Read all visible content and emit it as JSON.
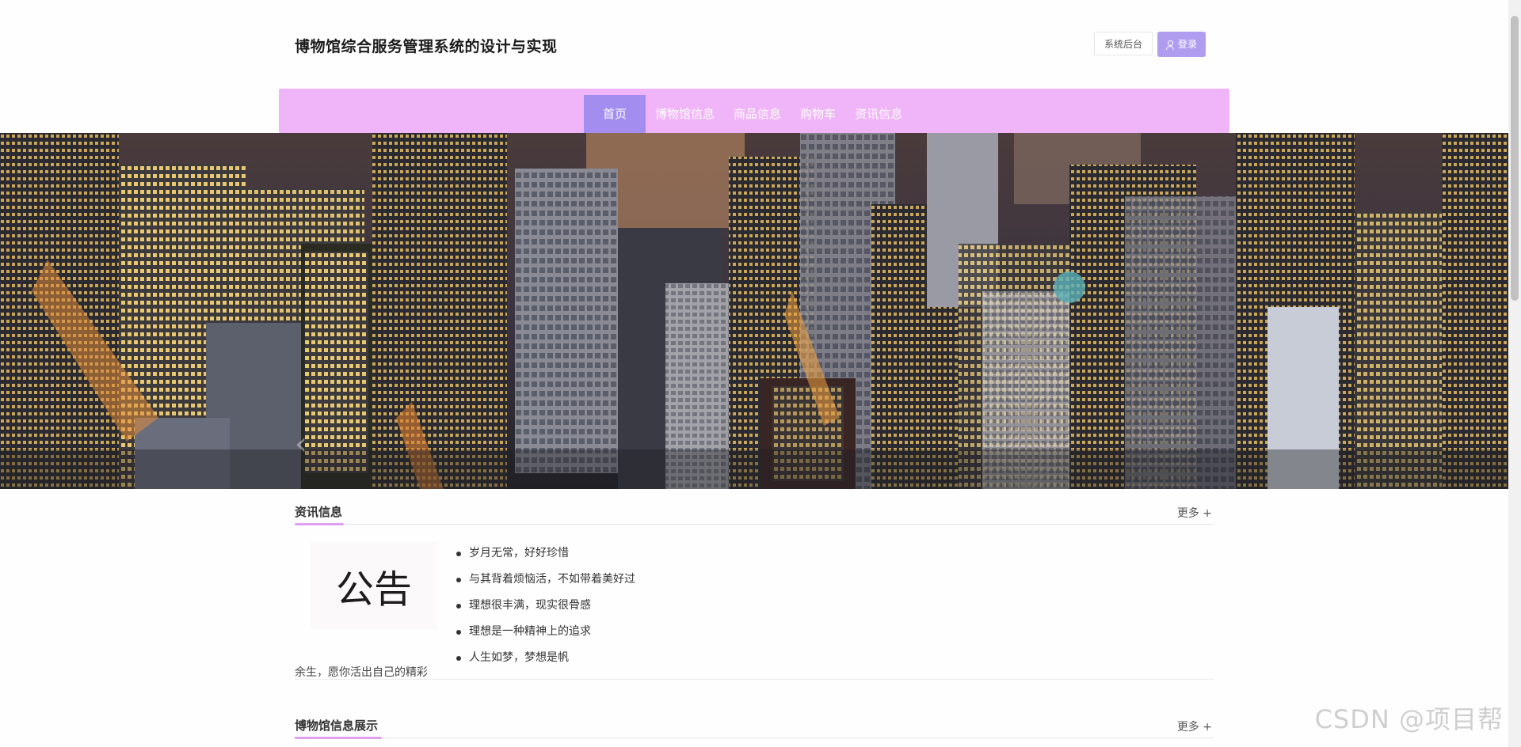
{
  "header": {
    "title": "博物馆综合服务管理系统的设计与实现",
    "admin_button": "系统后台",
    "login_button": "登录",
    "login_icon": "user-icon"
  },
  "nav": {
    "items": [
      {
        "label": "首页",
        "active": true
      },
      {
        "label": "博物馆信息",
        "active": false
      },
      {
        "label": "商品信息",
        "active": false
      },
      {
        "label": "购物车",
        "active": false
      },
      {
        "label": "资讯信息",
        "active": false
      }
    ]
  },
  "banner": {
    "prev_glyph": "‹",
    "image_description": "city-skyline-night"
  },
  "news_section": {
    "title": "资讯信息",
    "more": "更多 +",
    "notice_card": "公告",
    "description": "余生，愿你活出自己的精彩",
    "items": [
      "岁月无常，好好珍惜",
      "与其背着烦恼活，不如带着美好过",
      "理想很丰满，现实很骨感",
      "理想是一种精神上的追求",
      "人生如梦，梦想是帆"
    ]
  },
  "museum_section": {
    "title": "博物馆信息展示",
    "more": "更多 +"
  },
  "watermark": "CSDN @项目帮",
  "colors": {
    "nav_bg": "#f0b5f8",
    "nav_active": "#a38ef0",
    "login_bg": "#b19df0",
    "accent_underline": "#e0a0f0"
  }
}
